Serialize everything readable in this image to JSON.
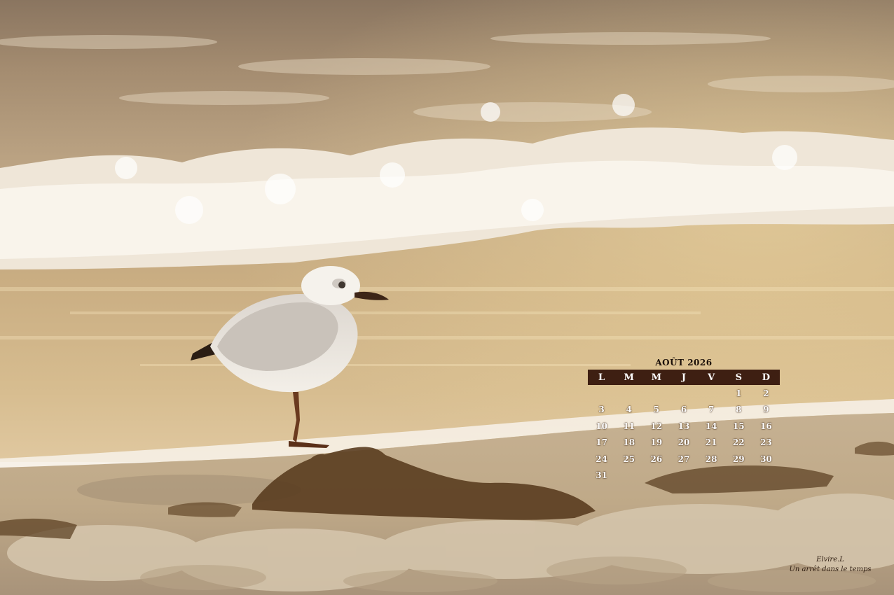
{
  "calendar": {
    "title": "AOÛT 2026",
    "weekdays": [
      "L",
      "M",
      "M",
      "J",
      "V",
      "S",
      "D"
    ],
    "weeks": [
      [
        "",
        "",
        "",
        "",
        "",
        "1",
        "2"
      ],
      [
        "3",
        "4",
        "5",
        "6",
        "7",
        "8",
        "9"
      ],
      [
        "10",
        "11",
        "12",
        "13",
        "14",
        "15",
        "16"
      ],
      [
        "17",
        "18",
        "19",
        "20",
        "21",
        "22",
        "23"
      ],
      [
        "24",
        "25",
        "26",
        "27",
        "28",
        "29",
        "30"
      ],
      [
        "31",
        "",
        "",
        "",
        "",
        "",
        ""
      ]
    ]
  },
  "signature": {
    "name": "Elvire.L",
    "tagline": "Un arrêt dans le temps"
  },
  "colors": {
    "calendar_header": "#3e1f12",
    "water_gold": "#c9a97a",
    "sand": "#cdb89a"
  }
}
